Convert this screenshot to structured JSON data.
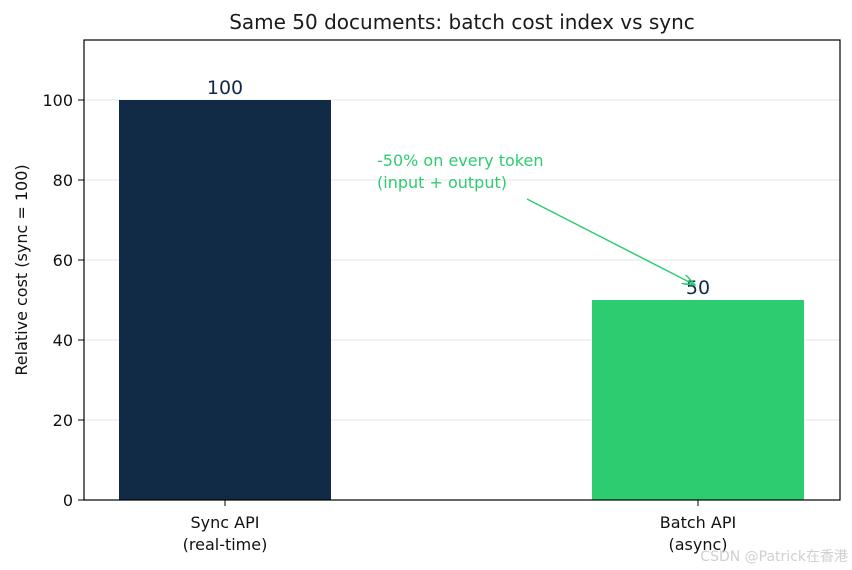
{
  "chart_data": {
    "type": "bar",
    "title": "Same 50 documents: batch cost index vs sync",
    "ylabel": "Relative cost (sync = 100)",
    "xlabel": "",
    "categories": [
      [
        "Sync API",
        "(real-time)"
      ],
      [
        "Batch API",
        "(async)"
      ]
    ],
    "values": [
      100,
      50
    ],
    "data_labels": [
      "100",
      "50"
    ],
    "bar_colors": [
      "#112a45",
      "#2ecc71"
    ],
    "ylim": [
      0,
      115
    ],
    "yticks": [
      0,
      20,
      40,
      60,
      80,
      100
    ],
    "grid": true,
    "annotation": {
      "lines": [
        "-50% on every token",
        "(input + output)"
      ],
      "color": "#2ecc71",
      "arrow_target_category": 1,
      "arrow_target_value": 55
    }
  },
  "watermark": "CSDN @Patrick在香港"
}
